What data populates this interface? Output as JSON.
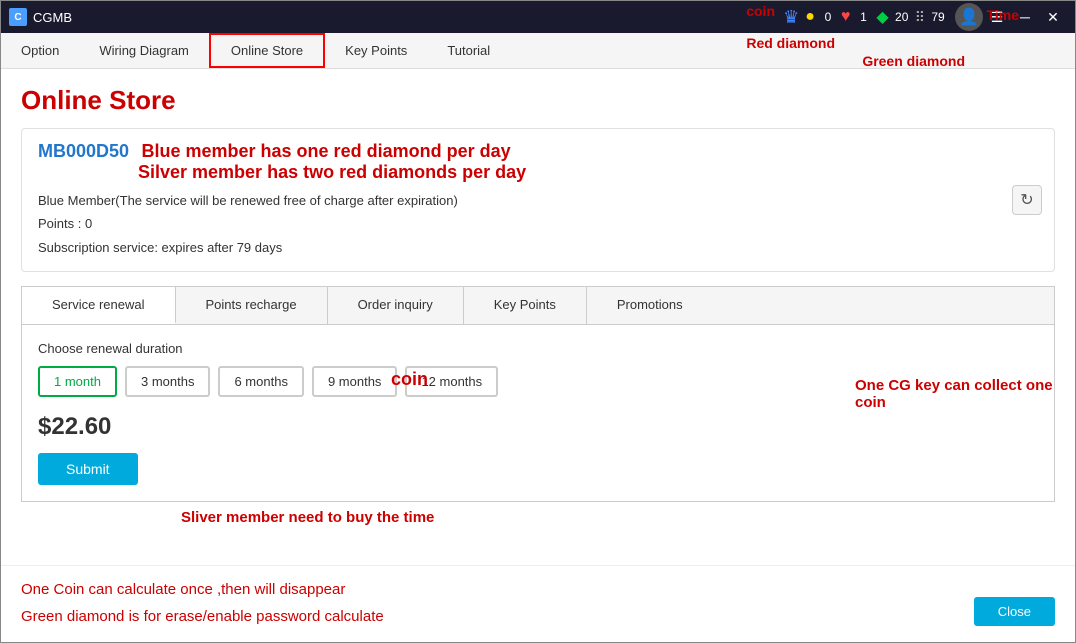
{
  "window": {
    "title": "CGMB",
    "titlebar_icon": "C"
  },
  "titlebar": {
    "icons": {
      "crown_count": "0",
      "heart_count": "1",
      "green_count": "20",
      "time_count": "79"
    }
  },
  "menubar": {
    "items": [
      {
        "label": "Option",
        "active": false
      },
      {
        "label": "Wiring Diagram",
        "active": false
      },
      {
        "label": "Online Store",
        "active": true
      },
      {
        "label": "Key Points",
        "active": false
      },
      {
        "label": "Tutorial",
        "active": false
      }
    ]
  },
  "page": {
    "title": "Online Store"
  },
  "user_info": {
    "id": "MB000D50",
    "annotation_blue": "Blue member has one red diamond per day",
    "annotation_silver": "Silver member has two red diamonds per day",
    "member_type": "Blue Member(The service will be renewed free of charge after expiration)",
    "points": "Points : 0",
    "subscription": "Subscription service: expires after 79 days"
  },
  "tabs": [
    {
      "label": "Service renewal",
      "active": true
    },
    {
      "label": "Points recharge",
      "active": false
    },
    {
      "label": "Order inquiry",
      "active": false
    },
    {
      "label": "Key Points",
      "active": false
    },
    {
      "label": "Promotions",
      "active": false
    }
  ],
  "service_renewal": {
    "choose_label": "Choose renewal duration",
    "durations": [
      {
        "label": "1 month",
        "selected": true
      },
      {
        "label": "3 months",
        "selected": false
      },
      {
        "label": "6 months",
        "selected": false
      },
      {
        "label": "9 months",
        "selected": false
      },
      {
        "label": "12 months",
        "selected": false
      }
    ],
    "price": "$22.60",
    "submit_label": "Submit"
  },
  "annotations": {
    "coin": "coin",
    "red_diamond": "Red diamond",
    "green_diamond": "Green diamond",
    "time": "Time",
    "points_recharge_coin": "coin",
    "key_points_text": "One CG key can collect one coin",
    "silver_member_text": "Sliver member need to buy the time"
  },
  "bottom": {
    "line1": "One Coin can calculate once ,then will disappear",
    "line2": "Green diamond is for erase/enable password calculate",
    "close_label": "Close"
  }
}
